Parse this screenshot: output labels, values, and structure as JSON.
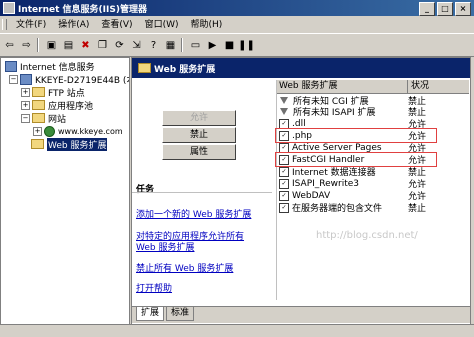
{
  "window": {
    "title": "Internet 信息服务(IIS)管理器"
  },
  "menu": {
    "items": [
      "文件(F)",
      "操作(A)",
      "查看(V)",
      "窗口(W)",
      "帮助(H)"
    ]
  },
  "tree": {
    "root": "Internet 信息服务",
    "server": "KKEYE-D2719E44B (本地计",
    "ftp": "FTP 站点",
    "apppools": "应用程序池",
    "sites": "网站",
    "site1": "www.kkeye.com",
    "webext": "Web 服务扩展"
  },
  "pane": {
    "header": "Web 服务扩展",
    "btn_allow": "允许",
    "btn_deny": "禁止",
    "btn_props": "属性",
    "tasks_title": "任务",
    "links": [
      "添加一个新的 Web 服务扩展",
      "对特定的应用程序允许所有 Web 服务扩展",
      "禁止所有 Web 服务扩展",
      "打开帮助"
    ],
    "tabs": [
      "扩展",
      "标准"
    ]
  },
  "list": {
    "headers": [
      "Web 服务扩展",
      "状况"
    ],
    "rows": [
      {
        "name": "所有未知 CGI 扩展",
        "status": "禁止",
        "icon": "filter-icon"
      },
      {
        "name": "所有未知 ISAPI 扩展",
        "status": "禁止",
        "icon": "filter-icon"
      },
      {
        "name": ".dll",
        "status": "允许",
        "icon": "extension-icon"
      },
      {
        "name": ".php",
        "status": "允许",
        "icon": "extension-icon"
      },
      {
        "name": "Active Server Pages",
        "status": "允许",
        "icon": "extension-icon"
      },
      {
        "name": "FastCGI Handler",
        "status": "允许",
        "icon": "extension-icon"
      },
      {
        "name": "Internet 数据连接器",
        "status": "禁止",
        "icon": "extension-icon"
      },
      {
        "name": "ISAPI_Rewrite3",
        "status": "允许",
        "icon": "extension-icon"
      },
      {
        "name": "WebDAV",
        "status": "允许",
        "icon": "extension-icon"
      },
      {
        "name": "在服务器端的包含文件",
        "status": "禁止",
        "icon": "extension-icon"
      }
    ]
  },
  "watermark": "http://blog.csdn.net/",
  "colors": {
    "title_bg": "#0a246a",
    "link": "#0000c0",
    "highlight_box": "#e04040"
  }
}
